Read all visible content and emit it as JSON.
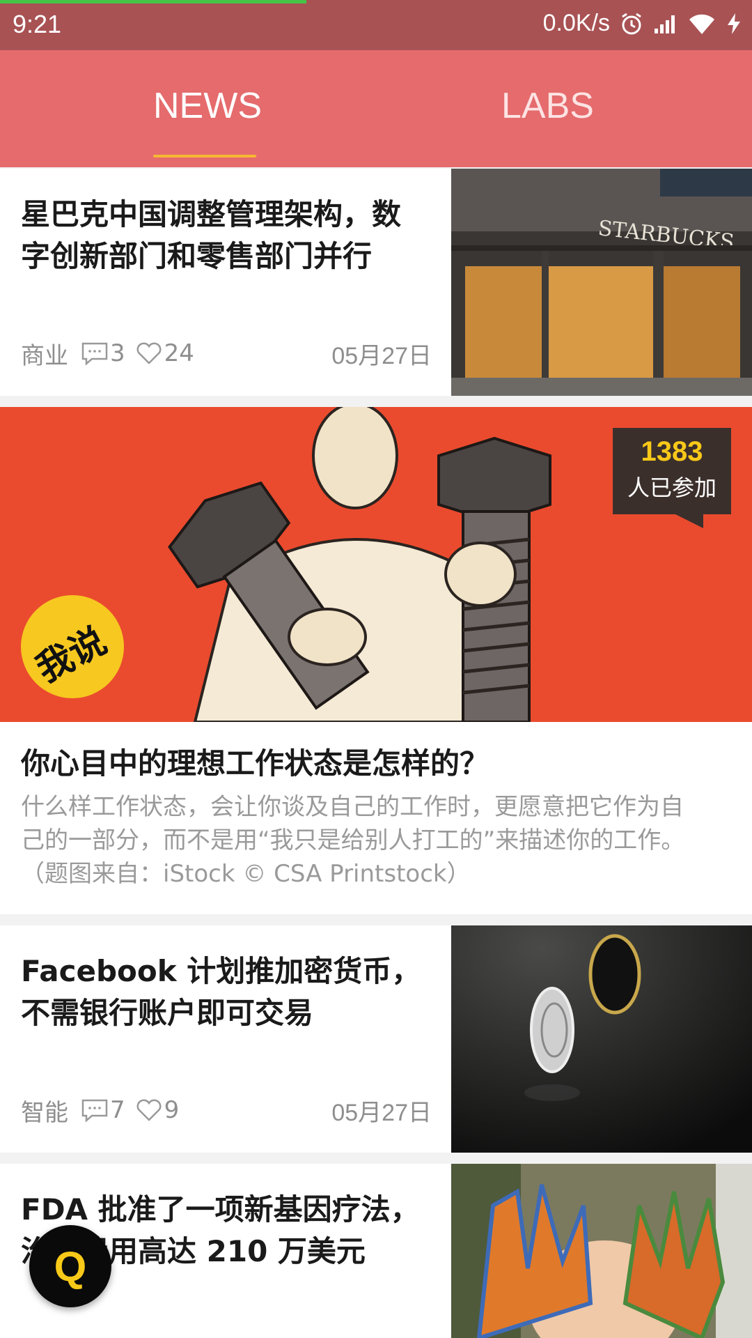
{
  "status_bar": {
    "time": "9:21",
    "net_speed": "0.0K/s",
    "icons": [
      "alarm-icon",
      "signal-icon",
      "wifi-icon",
      "charging-icon"
    ]
  },
  "tabs": [
    {
      "label": "NEWS",
      "active": true
    },
    {
      "label": "LABS",
      "active": false
    }
  ],
  "feed": [
    {
      "title_line1": "星巴克中国调整管理架构，数",
      "title_line2": "字创新部门和零售部门并行",
      "category": "商业",
      "comments": "3",
      "likes": "24",
      "date": "05月27日",
      "thumbnail": "starbucks-storefront-photo"
    },
    {
      "title_line1": "Facebook 计划推加密货币，",
      "title_line2": "不需银行账户即可交易",
      "category": "智能",
      "comments": "7",
      "likes": "9",
      "date": "05月27日",
      "thumbnail": "coins-on-dark-surface-photo"
    },
    {
      "title_line1": "FDA 批准了一项新基因疗法，",
      "title_line2": "治疗费用高达 210 万美元",
      "thumbnail": "child-painted-hands-photo"
    }
  ],
  "featured": {
    "participants": "1383",
    "participants_label": "人已参加",
    "sticker": "我说",
    "title": "你心目中的理想工作状态是怎样的？",
    "desc_line1": "什么样工作状态，会让你谈及自己的工作时，更愿意把它作为自",
    "desc_line2": "己的一部分，而不是用“我只是给别人打工的”来描述你的工作。",
    "desc_line3": "（题图来自：iStock © CSA Printstock）",
    "image": "vintage-illustration-man-holding-bolts"
  },
  "fab": {
    "label": "Q"
  },
  "colors": {
    "status_bar": "#a85254",
    "tab_bar": "#e56b6d",
    "tab_indicator": "#f7b733",
    "badge_number": "#f8c918",
    "feature_bg": "#ea4b2e"
  }
}
